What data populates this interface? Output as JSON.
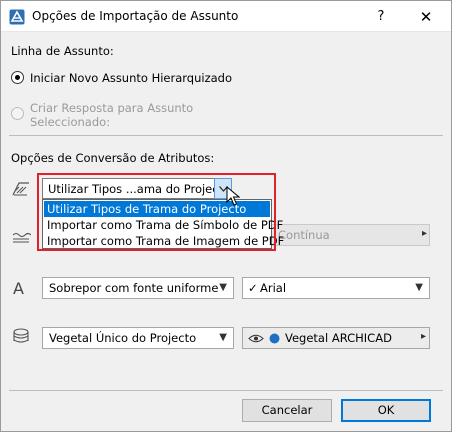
{
  "window": {
    "title": "Opções de Importação de Assunto",
    "help": "?",
    "close": "✕"
  },
  "subject_line": {
    "heading": "Linha de Assunto:",
    "option_new": "Iniciar Novo Assunto Hierarquizado",
    "option_reply": "Criar Resposta para Assunto Seleccionado:",
    "option_reply_line1": "Criar Resposta para Assunto",
    "option_reply_line2": "Seleccionado:",
    "selected": "option_new"
  },
  "attribute_conversion": {
    "heading": "Opções de Conversão de Atributos:",
    "fill_dropdown": {
      "value": "Utilizar Tipos ...ama do Projecto",
      "options": [
        "Utilizar Tipos de Trama do Projecto",
        "Importar como Trama de Símbolo de PDF",
        "Importar como Trama de Imagem de PDF"
      ],
      "selected_index": 0
    },
    "line_type": {
      "value": "Contínua"
    },
    "font_mode": {
      "value": "Sobrepor com fonte uniforme"
    },
    "font": {
      "value": "Arial",
      "check": "✓"
    },
    "surface_mode": {
      "value": "Vegetal Único do Projecto"
    },
    "surface": {
      "value": "Vegetal ARCHICAD"
    }
  },
  "buttons": {
    "cancel": "Cancelar",
    "ok": "OK"
  },
  "colors": {
    "highlight": "#e0202a",
    "selection": "#0078d7"
  }
}
